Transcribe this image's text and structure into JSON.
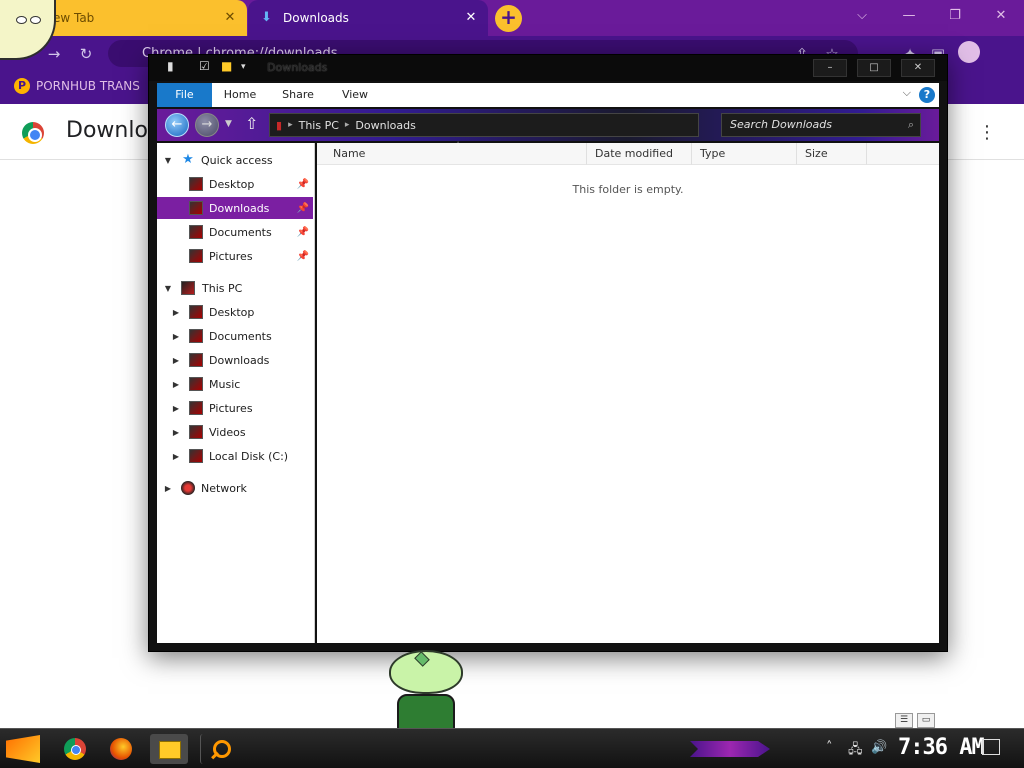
{
  "browser": {
    "tabs": [
      {
        "label": "New Tab"
      },
      {
        "label": "Downloads"
      }
    ],
    "tab_close_glyph": "✕",
    "new_tab_glyph": "+",
    "window_controls": [
      "⌵",
      "—",
      "❐",
      "✕"
    ],
    "address": "Chrome  |  chrome://downloads",
    "bookmarks": [
      {
        "label": "PORNHUB TRANS"
      }
    ],
    "page_title": "Downloads",
    "colors": {
      "tabstrip": "#6a1b9a",
      "active_tab": "#4a148c",
      "inactive_tab": "#fbc02d"
    }
  },
  "explorer": {
    "title": "Downloads",
    "window_controls": [
      "–",
      "□",
      "✕"
    ],
    "ribbon_tabs": [
      {
        "label": "File"
      },
      {
        "label": "Home"
      },
      {
        "label": "Share"
      },
      {
        "label": "View"
      }
    ],
    "help_glyph": "?",
    "address_path": [
      "This PC",
      "Downloads"
    ],
    "search_placeholder": "Search Downloads",
    "nav": {
      "quick_access": {
        "label": "Quick access",
        "items": [
          {
            "label": "Desktop",
            "pinned": true
          },
          {
            "label": "Downloads",
            "pinned": true,
            "selected": true
          },
          {
            "label": "Documents",
            "pinned": true
          },
          {
            "label": "Pictures",
            "pinned": true
          }
        ]
      },
      "this_pc": {
        "label": "This PC",
        "items": [
          {
            "label": "Desktop"
          },
          {
            "label": "Documents"
          },
          {
            "label": "Downloads"
          },
          {
            "label": "Music"
          },
          {
            "label": "Pictures"
          },
          {
            "label": "Videos"
          },
          {
            "label": "Local Disk (C:)"
          }
        ]
      },
      "network": {
        "label": "Network"
      }
    },
    "columns": [
      {
        "label": "Name"
      },
      {
        "label": "Date modified"
      },
      {
        "label": "Type"
      },
      {
        "label": "Size"
      }
    ],
    "empty_message": "This folder is empty.",
    "colors": {
      "selection": "#7b1fa2",
      "file_tab": "#1979ca"
    }
  },
  "taskbar": {
    "apps": [
      "start-icon",
      "chrome-icon",
      "firefox-icon",
      "file-explorer-icon",
      "search-icon"
    ],
    "clock": "7:36 AM"
  }
}
